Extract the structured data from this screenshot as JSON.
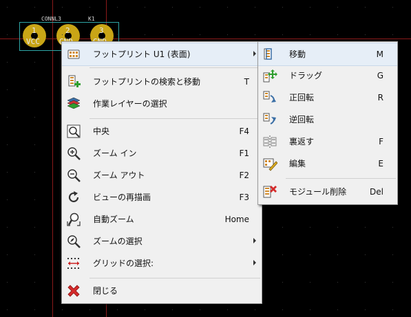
{
  "footprint": {
    "value_label": "CONNL3",
    "ref_label": "K1",
    "pads": [
      {
        "number": "1",
        "net": "VCC"
      },
      {
        "number": "2",
        "net": "GND"
      },
      {
        "number": "3",
        "net": "GND"
      }
    ]
  },
  "context_menu": {
    "items": [
      {
        "label": "フットプリント U1 (表面)",
        "shortcut": "",
        "submenu": true,
        "icon": "footprint-icon"
      },
      {
        "label": "フットプリントの検索と移動",
        "shortcut": "T",
        "submenu": false,
        "icon": "footprint-search-icon"
      },
      {
        "label": "作業レイヤーの選択",
        "shortcut": "",
        "submenu": false,
        "icon": "layers-icon"
      },
      {
        "label": "中央",
        "shortcut": "F4",
        "submenu": false,
        "icon": "zoom-center-icon"
      },
      {
        "label": "ズーム イン",
        "shortcut": "F1",
        "submenu": false,
        "icon": "zoom-in-icon"
      },
      {
        "label": "ズーム アウト",
        "shortcut": "F2",
        "submenu": false,
        "icon": "zoom-out-icon"
      },
      {
        "label": "ビューの再描画",
        "shortcut": "F3",
        "submenu": false,
        "icon": "redraw-icon"
      },
      {
        "label": "自動ズーム",
        "shortcut": "Home",
        "submenu": false,
        "icon": "zoom-auto-icon"
      },
      {
        "label": "ズームの選択",
        "shortcut": "",
        "submenu": true,
        "icon": "zoom-select-icon"
      },
      {
        "label": "グリッドの選択:",
        "shortcut": "",
        "submenu": true,
        "icon": "grid-icon"
      },
      {
        "label": "閉じる",
        "shortcut": "",
        "submenu": false,
        "icon": "close-icon"
      }
    ]
  },
  "submenu": {
    "items": [
      {
        "label": "移動",
        "shortcut": "M",
        "icon": "move-icon"
      },
      {
        "label": "ドラッグ",
        "shortcut": "G",
        "icon": "drag-icon"
      },
      {
        "label": "正回転",
        "shortcut": "R",
        "icon": "rotate-cw-icon"
      },
      {
        "label": "逆回転",
        "shortcut": "",
        "icon": "rotate-ccw-icon"
      },
      {
        "label": "裏返す",
        "shortcut": "F",
        "icon": "flip-icon"
      },
      {
        "label": "編集",
        "shortcut": "E",
        "icon": "edit-icon"
      },
      {
        "label": "モジュール削除",
        "shortcut": "Del",
        "icon": "delete-module-icon"
      }
    ]
  },
  "colors": {
    "canvas": "#000000",
    "pad": "#c9a516",
    "outline": "#2fa7a7",
    "board_edge": "#8b1a1a",
    "menu_bg": "#f0f0f0",
    "highlight": "#e6eef7"
  }
}
